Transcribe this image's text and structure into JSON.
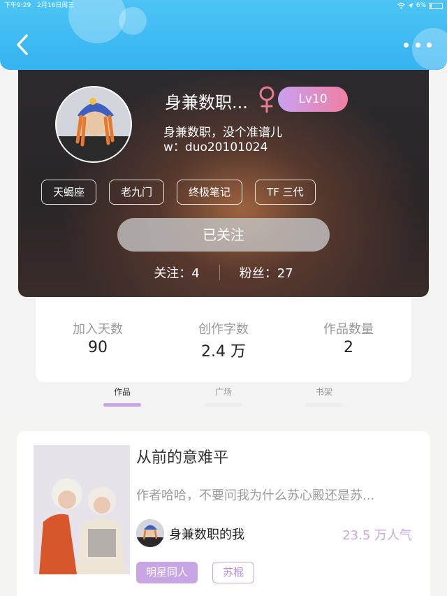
{
  "colors": {
    "header_blue": "#35b3f2",
    "accent_purple": "#c8a6e6",
    "level_gradient_start": "#c9a0f0",
    "level_gradient_end": "#ef7fa3",
    "gender_pink": "#e77a95"
  },
  "status_bar": {
    "time": "下午9:29",
    "date": "2月16日周三",
    "battery": "6%"
  },
  "header": {
    "back_icon": "chevron-left-icon",
    "more_icon": "more-dots-icon"
  },
  "profile": {
    "nickname": "身兼数职...",
    "gender_icon": "female-icon",
    "level": "Lv10",
    "bio": "身兼数职，没个准谱儿",
    "wechat": "w：duo20101024",
    "tags": [
      "天蝎座",
      "老九门",
      "终极笔记",
      "TF 三代"
    ],
    "follow_button": "已关注",
    "following": "关注：4",
    "fans": "粉丝：27"
  },
  "stats": {
    "days_label": "加入天数",
    "days_value": "90",
    "words_label": "创作字数",
    "words_value": "2.4 万",
    "works_label": "作品数量",
    "works_value": "2"
  },
  "tabs": {
    "items": [
      "作品",
      "广场",
      "书架"
    ],
    "active_index": 0
  },
  "work": {
    "title": "从前的意难平",
    "description": "作者哈哈，不要问我为什么苏心殿还是苏...",
    "author": "身兼数职的我",
    "popularity": "23.5 万人气",
    "tags": [
      "明星同人",
      "苏棍"
    ]
  }
}
